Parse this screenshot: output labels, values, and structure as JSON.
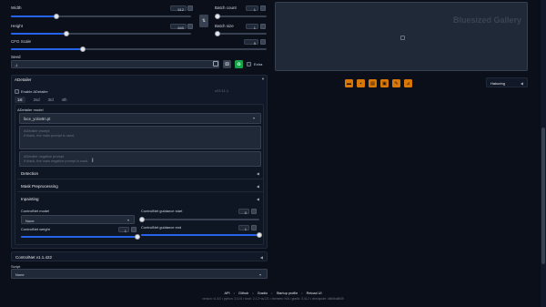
{
  "sliders": {
    "width": {
      "label": "Width",
      "value": "512",
      "fraction": 0.25
    },
    "height": {
      "label": "Height",
      "value": "640",
      "fraction": 0.33
    },
    "batch_count": {
      "label": "Batch count",
      "value": "1",
      "fraction": 0.0
    },
    "batch_size": {
      "label": "Batch size",
      "value": "1",
      "fraction": 0.0
    },
    "cfg_scale": {
      "label": "CFG Scale",
      "value": "9",
      "fraction": 0.28
    }
  },
  "seed": {
    "label": "Seed",
    "value": "-1",
    "extra_label": "Extra"
  },
  "swap_icon": "swap-icon",
  "adetailer": {
    "title": "ADetailer",
    "enable_label": "Enable ADetailer",
    "version": "v23.11.1",
    "tabs": [
      "1st",
      "2nd",
      "3rd",
      "4th"
    ],
    "model_label": "ADetailer model",
    "model_value": "face_yolov8n.pt",
    "prompt_label": "ADetailer prompt",
    "prompt_placeholder": "If blank, the main prompt is used.",
    "neg_prompt_label": "ADetailer negative prompt",
    "neg_prompt_placeholder": "If blank, the main negative prompt is used.",
    "sections": [
      "Detection",
      "Mask Preprocessing",
      "Inpainting"
    ],
    "controlnet_model_label": "ControlNet model",
    "controlnet_model_value": "None",
    "controlnet_weight": {
      "label": "ControlNet weight",
      "value": "1",
      "fraction": 0.5
    },
    "guidance_start": {
      "label": "ControlNet guidance start",
      "value": "0",
      "fraction": 0.0
    },
    "guidance_end": {
      "label": "ControlNet guidance end",
      "value": "1",
      "fraction": 1.0
    }
  },
  "controlnet": {
    "title": "ControlNet v1.1.422"
  },
  "script": {
    "label": "Script",
    "value": "None"
  },
  "output": {
    "watermark": "Bluesized Gallery",
    "extra_networks_label": "Hakuring"
  },
  "footer": {
    "links": [
      "API",
      "Github",
      "Gradio",
      "Startup profile",
      "Reload UI"
    ],
    "separator": "•",
    "versions": "version: v1.8.0  •  python: 3.10.6  •  torch: 2.1.2+cu121  •  xformers: N/A  •  gradio: 3.41.2  •  checkpoint: 4bb6ba8b59"
  },
  "colors": {
    "accent": "#2563eb",
    "tool_button": "#d97706",
    "background": "#0b0f19"
  }
}
